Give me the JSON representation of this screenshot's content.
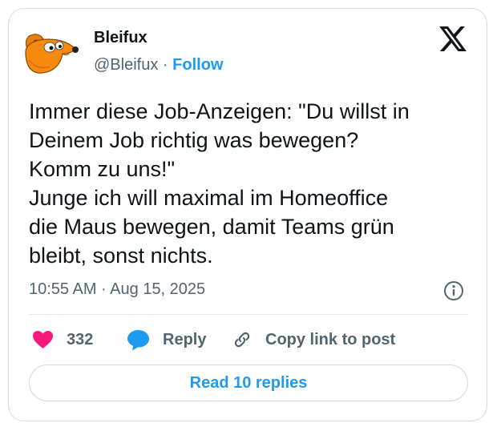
{
  "author": {
    "name": "Bleifux",
    "handle": "@Bleifux",
    "separator": "·",
    "follow_label": "Follow",
    "avatar_icon": "orange-fox-avatar"
  },
  "brand": {
    "logo_icon": "x-logo-icon"
  },
  "tweet": {
    "text": "Immer diese Job-Anzeigen: \"Du willst in\nDeinem Job richtig was bewegen?\nKomm zu uns!\"\nJunge ich will maximal im Homeoffice\ndie Maus bewegen, damit Teams grün\nbleibt, sonst nichts.",
    "timestamp": "10:55 AM · Aug 15, 2025"
  },
  "actions": {
    "like_count": "332",
    "reply_label": "Reply",
    "copy_label": "Copy link to post"
  },
  "footer": {
    "read_replies_label": "Read 10 replies"
  },
  "colors": {
    "accent": "#1d9bf0",
    "like": "#f91880",
    "text": "#0f1419",
    "muted": "#536471",
    "border": "#d6dbdf"
  }
}
